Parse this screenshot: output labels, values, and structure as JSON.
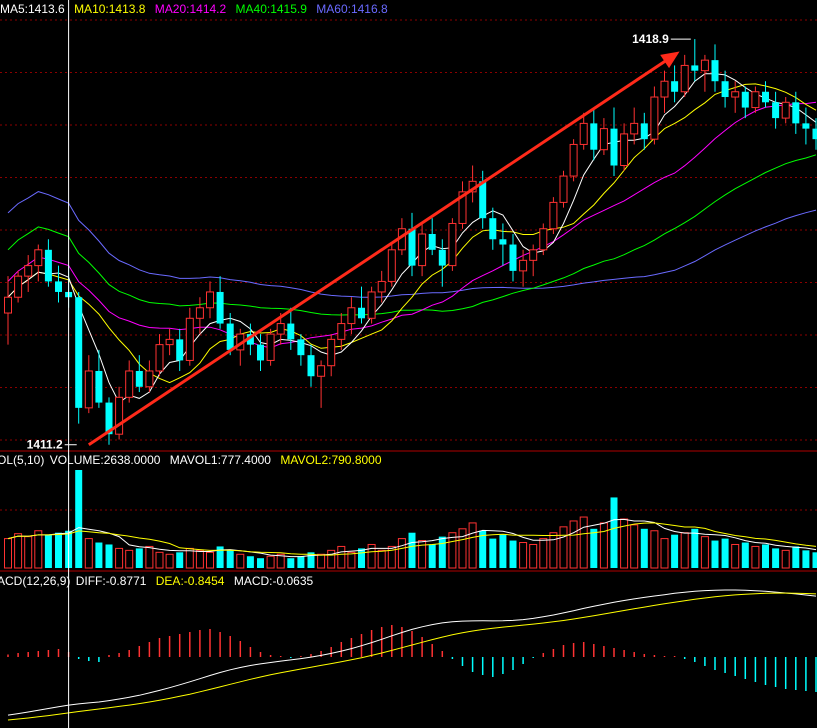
{
  "chart_data": [
    {
      "type": "candlestick",
      "panel": "price",
      "legend": [
        {
          "label": "MA5:1413.6",
          "color": "#ffffff"
        },
        {
          "label": "MA10:1413.8",
          "color": "#ffff00"
        },
        {
          "label": "MA20:1414.2",
          "color": "#ff00ff"
        },
        {
          "label": "MA40:1415.9",
          "color": "#00ff00"
        },
        {
          "label": "MA60:1416.8",
          "color": "#6a6aff"
        }
      ],
      "ylim": [
        1411.1,
        1419.3
      ],
      "annotations": [
        {
          "text": "1418.9",
          "kind": "max",
          "x_index": 68,
          "value": 1418.9
        },
        {
          "text": "1411.2",
          "kind": "min",
          "x_index": 7,
          "value": 1411.2
        }
      ],
      "grid": true,
      "colors": {
        "up": "#ff3232",
        "down": "#00ffff",
        "grid": "#8b0000",
        "arrow": "#ff2a1a"
      },
      "arrow": {
        "from": [
          8,
          1411.2
        ],
        "to": [
          66,
          1418.6
        ]
      },
      "cursor_index": 6
    },
    {
      "type": "bar",
      "panel": "volume",
      "header": [
        {
          "label": "OL(5,10)",
          "color": "#ffffff"
        },
        {
          "label": "VOLUME:2638.0000",
          "color": "#ffffff"
        },
        {
          "label": "MAVOL1:777.4000",
          "color": "#ffffff"
        },
        {
          "label": "MAVOL2:790.8000",
          "color": "#ffff00"
        }
      ]
    },
    {
      "type": "bar",
      "panel": "macd",
      "header": [
        {
          "label": "ACD(12,26,9)",
          "color": "#ffffff"
        },
        {
          "label": "DIFF:-0.8771",
          "color": "#ffffff"
        },
        {
          "label": "DEA:-0.8454",
          "color": "#ffff00"
        },
        {
          "label": "MACD:-0.0635",
          "color": "#ffffff"
        }
      ]
    }
  ],
  "candles": [
    [
      1413.7,
      1414.4,
      1413.1,
      1414.0
    ],
    [
      1414.0,
      1414.5,
      1413.9,
      1414.4
    ],
    [
      1414.4,
      1414.8,
      1414.1,
      1414.6
    ],
    [
      1414.6,
      1415.0,
      1414.3,
      1414.9
    ],
    [
      1414.9,
      1415.1,
      1414.2,
      1414.3
    ],
    [
      1414.3,
      1414.6,
      1413.9,
      1414.1
    ],
    [
      1414.1,
      1414.6,
      1413.8,
      1414.0
    ],
    [
      1414.0,
      1414.1,
      1411.6,
      1411.9
    ],
    [
      1411.9,
      1412.9,
      1411.8,
      1412.6
    ],
    [
      1412.6,
      1413.0,
      1411.9,
      1412.0
    ],
    [
      1412.0,
      1412.1,
      1411.2,
      1411.4
    ],
    [
      1411.4,
      1412.3,
      1411.3,
      1412.1
    ],
    [
      1412.1,
      1412.8,
      1412.0,
      1412.6
    ],
    [
      1412.6,
      1412.9,
      1412.2,
      1412.3
    ],
    [
      1412.3,
      1412.8,
      1412.2,
      1412.6
    ],
    [
      1412.6,
      1413.3,
      1412.5,
      1413.1
    ],
    [
      1413.1,
      1413.4,
      1412.9,
      1413.2
    ],
    [
      1413.2,
      1413.4,
      1412.6,
      1412.8
    ],
    [
      1412.8,
      1413.8,
      1412.7,
      1413.6
    ],
    [
      1413.6,
      1414.0,
      1413.3,
      1413.8
    ],
    [
      1413.8,
      1414.3,
      1413.6,
      1414.1
    ],
    [
      1414.1,
      1414.4,
      1413.4,
      1413.5
    ],
    [
      1413.5,
      1413.7,
      1412.9,
      1413.0
    ],
    [
      1413.0,
      1413.4,
      1412.7,
      1413.3
    ],
    [
      1413.3,
      1413.5,
      1412.9,
      1413.1
    ],
    [
      1413.1,
      1413.3,
      1412.6,
      1412.8
    ],
    [
      1412.8,
      1413.4,
      1412.7,
      1413.3
    ],
    [
      1413.3,
      1413.7,
      1413.1,
      1413.5
    ],
    [
      1413.5,
      1413.8,
      1413.0,
      1413.2
    ],
    [
      1413.2,
      1413.3,
      1412.7,
      1412.9
    ],
    [
      1412.9,
      1413.1,
      1412.3,
      1412.5
    ],
    [
      1412.5,
      1412.8,
      1411.9,
      1412.7
    ],
    [
      1412.7,
      1413.3,
      1412.5,
      1413.2
    ],
    [
      1413.2,
      1413.7,
      1413.0,
      1413.5
    ],
    [
      1413.5,
      1414.0,
      1413.3,
      1413.8
    ],
    [
      1413.8,
      1414.2,
      1413.5,
      1413.6
    ],
    [
      1413.6,
      1414.2,
      1413.5,
      1414.1
    ],
    [
      1414.1,
      1414.5,
      1413.9,
      1414.3
    ],
    [
      1414.3,
      1415.0,
      1414.2,
      1414.9
    ],
    [
      1414.9,
      1415.5,
      1414.8,
      1415.3
    ],
    [
      1415.3,
      1415.6,
      1414.4,
      1414.6
    ],
    [
      1414.6,
      1415.4,
      1414.4,
      1415.2
    ],
    [
      1415.2,
      1415.5,
      1414.8,
      1414.9
    ],
    [
      1414.9,
      1415.1,
      1414.2,
      1414.6
    ],
    [
      1414.6,
      1415.5,
      1414.5,
      1415.4
    ],
    [
      1415.4,
      1416.2,
      1415.3,
      1416.0
    ],
    [
      1416.0,
      1416.5,
      1415.8,
      1416.2
    ],
    [
      1416.2,
      1416.4,
      1415.3,
      1415.5
    ],
    [
      1415.5,
      1415.7,
      1414.9,
      1415.1
    ],
    [
      1415.1,
      1415.4,
      1414.6,
      1415.0
    ],
    [
      1415.0,
      1415.2,
      1414.3,
      1414.5
    ],
    [
      1414.5,
      1414.9,
      1414.2,
      1414.7
    ],
    [
      1414.7,
      1415.0,
      1414.4,
      1414.9
    ],
    [
      1414.9,
      1415.4,
      1414.8,
      1415.3
    ],
    [
      1415.3,
      1415.9,
      1415.2,
      1415.8
    ],
    [
      1415.8,
      1416.4,
      1415.7,
      1416.3
    ],
    [
      1416.3,
      1417.0,
      1416.2,
      1416.9
    ],
    [
      1416.9,
      1417.5,
      1416.8,
      1417.3
    ],
    [
      1417.3,
      1417.6,
      1416.6,
      1416.8
    ],
    [
      1416.8,
      1417.4,
      1416.7,
      1417.2
    ],
    [
      1417.2,
      1417.6,
      1416.3,
      1416.5
    ],
    [
      1416.5,
      1417.3,
      1416.4,
      1417.1
    ],
    [
      1417.1,
      1417.6,
      1416.9,
      1417.3
    ],
    [
      1417.3,
      1417.5,
      1416.8,
      1417.0
    ],
    [
      1417.0,
      1418.0,
      1416.9,
      1417.8
    ],
    [
      1417.8,
      1418.3,
      1417.5,
      1418.1
    ],
    [
      1418.1,
      1418.4,
      1417.7,
      1417.9
    ],
    [
      1417.9,
      1418.6,
      1417.8,
      1418.4
    ],
    [
      1418.4,
      1418.9,
      1418.1,
      1418.3
    ],
    [
      1418.3,
      1418.6,
      1417.9,
      1418.5
    ],
    [
      1418.5,
      1418.8,
      1417.9,
      1418.1
    ],
    [
      1418.1,
      1418.3,
      1417.6,
      1417.8
    ],
    [
      1417.8,
      1418.1,
      1417.5,
      1417.9
    ],
    [
      1417.9,
      1418.0,
      1417.4,
      1417.6
    ],
    [
      1417.6,
      1418.0,
      1417.5,
      1417.9
    ],
    [
      1417.9,
      1418.1,
      1417.6,
      1417.7
    ],
    [
      1417.7,
      1417.9,
      1417.2,
      1417.4
    ],
    [
      1417.4,
      1417.8,
      1417.3,
      1417.7
    ],
    [
      1417.7,
      1417.9,
      1417.1,
      1417.3
    ],
    [
      1417.3,
      1417.6,
      1416.9,
      1417.2
    ],
    [
      1417.2,
      1417.4,
      1416.8,
      1417.0
    ]
  ],
  "volumes": [
    0.3,
    0.35,
    0.32,
    0.38,
    0.34,
    0.36,
    0.38,
    1.0,
    0.3,
    0.26,
    0.24,
    0.2,
    0.18,
    0.2,
    0.22,
    0.16,
    0.14,
    0.16,
    0.2,
    0.18,
    0.16,
    0.22,
    0.18,
    0.14,
    0.12,
    0.1,
    0.12,
    0.14,
    0.1,
    0.12,
    0.16,
    0.14,
    0.18,
    0.22,
    0.16,
    0.2,
    0.24,
    0.18,
    0.22,
    0.3,
    0.36,
    0.28,
    0.24,
    0.32,
    0.36,
    0.4,
    0.46,
    0.38,
    0.3,
    0.34,
    0.28,
    0.26,
    0.24,
    0.3,
    0.36,
    0.42,
    0.48,
    0.52,
    0.4,
    0.46,
    0.72,
    0.5,
    0.44,
    0.4,
    0.38,
    0.3,
    0.34,
    0.36,
    0.4,
    0.32,
    0.28,
    0.3,
    0.24,
    0.26,
    0.22,
    0.24,
    0.2,
    0.18,
    0.22,
    0.18,
    0.16
  ],
  "macd_hist": [
    0.05,
    0.08,
    0.1,
    0.12,
    0.14,
    0.16,
    0.1,
    -0.04,
    -0.08,
    -0.1,
    0.04,
    0.08,
    0.14,
    0.22,
    0.3,
    0.38,
    0.42,
    0.46,
    0.5,
    0.54,
    0.56,
    0.5,
    0.42,
    0.32,
    0.2,
    0.1,
    0.04,
    0.02,
    -0.02,
    0.02,
    0.06,
    0.12,
    0.2,
    0.3,
    0.38,
    0.46,
    0.54,
    0.6,
    0.64,
    0.6,
    0.52,
    0.4,
    0.26,
    0.12,
    -0.04,
    -0.18,
    -0.3,
    -0.36,
    -0.4,
    -0.34,
    -0.26,
    -0.14,
    -0.02,
    0.08,
    0.16,
    0.24,
    0.28,
    0.3,
    0.26,
    0.22,
    0.18,
    0.14,
    0.1,
    0.06,
    0.04,
    0.02,
    0.02,
    -0.04,
    -0.1,
    -0.18,
    -0.26,
    -0.32,
    -0.38,
    -0.44,
    -0.5,
    -0.56,
    -0.6,
    -0.64,
    -0.66,
    -0.68,
    -0.7
  ]
}
